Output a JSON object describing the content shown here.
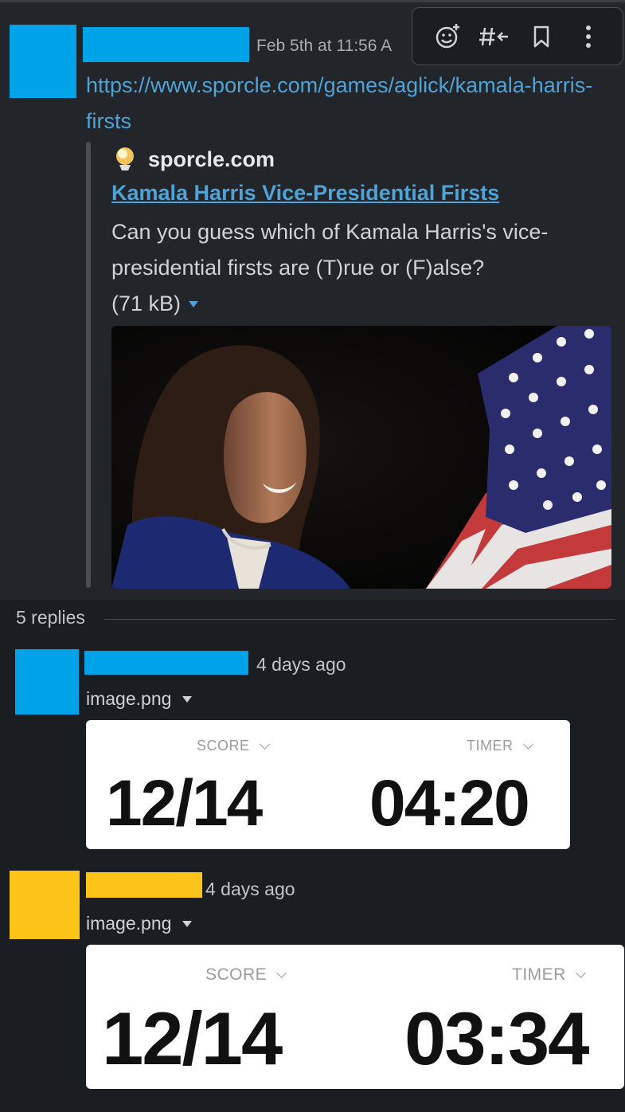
{
  "colors": {
    "background": "#1a1d21",
    "parent_background": "#222529",
    "link": "#4fa3d6",
    "avatar_blue": "#00a2e8",
    "avatar_yellow": "#fcc419",
    "muted_text": "#abacad"
  },
  "toolbar": {
    "icons": [
      "add-reaction-icon",
      "reply-in-channel-icon",
      "bookmark-icon",
      "more-actions-icon"
    ]
  },
  "parent": {
    "timestamp": "Feb 5th at 11:56 A",
    "link": "https://www.sporcle.com/games/aglick/kamala-harris-firsts",
    "unfurl": {
      "site": "sporcle.com",
      "title": "Kamala Harris Vice-Presidential Firsts",
      "description": "Can you guess which of Kamala Harris's vice-presidential firsts are (T)rue or (F)alse?",
      "size": "(71 kB)"
    }
  },
  "thread": {
    "replies_label": "5 replies",
    "replies": [
      {
        "avatar_color": "#00a2e8",
        "timestamp": "4 days ago",
        "file_name": "image.png",
        "score_label": "SCORE",
        "score": "12/14",
        "timer_label": "TIMER",
        "timer": "04:20"
      },
      {
        "avatar_color": "#fcc419",
        "timestamp": "4 days ago",
        "file_name": "image.png",
        "score_label": "SCORE",
        "score": "12/14",
        "timer_label": "TIMER",
        "timer": "03:34"
      }
    ]
  }
}
